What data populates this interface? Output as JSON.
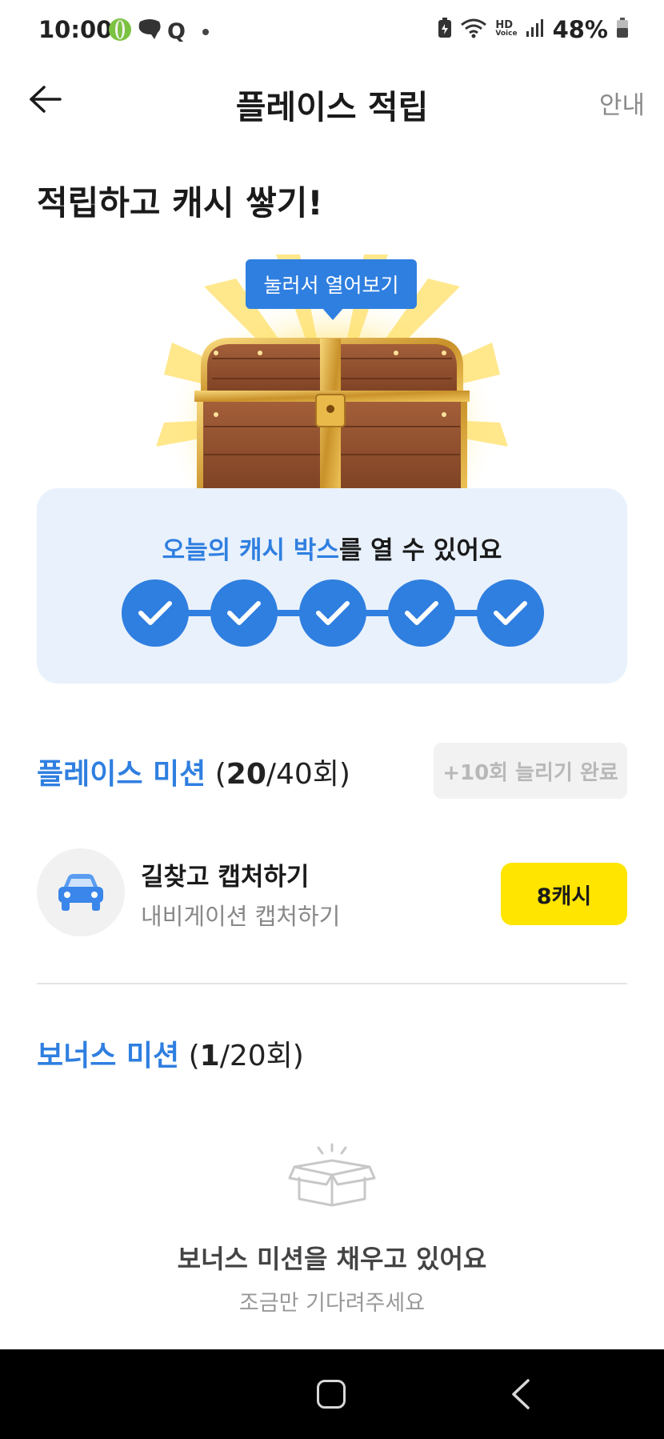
{
  "status_bar": {
    "time": "10:00",
    "left_icons": [
      "app-icon-green",
      "chat-bubble-icon",
      "q-icon",
      "dot-icon"
    ],
    "q_label": "Q",
    "battery_text": "48%",
    "right_icons": [
      "battery-saver-icon",
      "wifi-icon",
      "hd-voice-icon",
      "signal-icon",
      "battery-icon"
    ],
    "hd_label_top": "HD",
    "hd_label_bottom": "Voice"
  },
  "header": {
    "back_icon": "back-arrow-icon",
    "title": "플레이스 적립",
    "guide_label": "안내"
  },
  "headline": "적립하고 캐시 쌓기!",
  "chest": {
    "tooltip": "눌러서 열어보기",
    "icon": "treasure-chest-icon"
  },
  "cash_box": {
    "title_accent": "오늘의 캐시 박스",
    "title_rest": "를 열 수 있어요",
    "steps_completed": 5,
    "steps_total": 5,
    "step_icon": "check-icon"
  },
  "place_mission": {
    "title": "플레이스 미션",
    "count_open": " (",
    "count_done": "20",
    "count_rest": "/40회)",
    "extend_label": "+10회 늘리기 완료"
  },
  "missions": [
    {
      "icon": "car-icon",
      "title": "길찾고 캡처하기",
      "subtitle": "내비게이션 캡처하기",
      "reward": "8캐시"
    }
  ],
  "bonus_mission": {
    "title": "보너스 미션",
    "count_open": " (",
    "count_done": "1",
    "count_rest": "/20회)",
    "empty_icon": "open-box-icon",
    "empty_title": "보너스 미션을 채우고 있어요",
    "empty_subtitle": "조금만 기다려주세요"
  },
  "nav_bar": {
    "icons": [
      "home-button-icon",
      "back-nav-icon"
    ]
  },
  "colors": {
    "accent": "#2f7fe0",
    "card_bg": "#e9f1fc",
    "reward_button": "#ffe500"
  }
}
